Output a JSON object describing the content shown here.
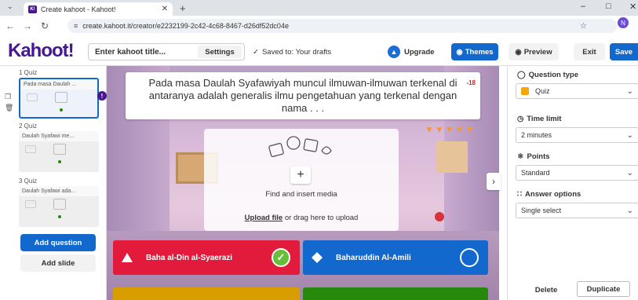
{
  "browser": {
    "tab_title": "Create kahoot - Kahoot!",
    "favicon": "K!",
    "url": "create.kahoot.it/creator/e2232199-2c42-4c68-8467-d26df52dc04e",
    "profile_initial": "N"
  },
  "header": {
    "logo": "Kahoot!",
    "title_placeholder": "Enter kahoot title...",
    "settings_label": "Settings",
    "saved_status": "Saved to: Your drafts",
    "upgrade_label": "Upgrade",
    "themes_label": "Themes",
    "preview_label": "Preview",
    "exit_label": "Exit",
    "save_label": "Save"
  },
  "sidebar": {
    "slides": [
      {
        "label": "1  Quiz",
        "preview": "Pada masa Daulah ..."
      },
      {
        "label": "2  Quiz",
        "preview": "Daulah Syafawi me..."
      },
      {
        "label": "3  Quiz",
        "preview": "Daulah Syafawi ada..."
      }
    ],
    "add_question_label": "Add question",
    "add_slide_label": "Add slide"
  },
  "editor": {
    "question_text": "Pada masa Daulah Syafawiyah muncul ilmuwan-ilmuwan terkenal di antaranya adalah generalis ilmu pengetahuan yang terkenal dengan nama . . .",
    "char_counter": "-18",
    "media": {
      "find_label": "Find and insert media",
      "upload_link": "Upload file",
      "upload_rest": " or drag here to upload"
    },
    "answers": [
      {
        "text": "Baha al-Din al-Syaerazi",
        "color": "#e21b3c",
        "shape": "triangle",
        "correct": true
      },
      {
        "text": "Baharuddin Al-Amili",
        "color": "#1368ce",
        "shape": "diamond",
        "correct": false
      },
      {
        "text": "",
        "color": "#d89e00",
        "shape": "circle",
        "correct": false
      },
      {
        "text": "",
        "color": "#26890c",
        "shape": "square",
        "correct": false
      }
    ]
  },
  "panel": {
    "question_type_label": "Question type",
    "question_type_value": "Quiz",
    "time_limit_label": "Time limit",
    "time_limit_value": "2 minutes",
    "points_label": "Points",
    "points_value": "Standard",
    "answer_options_label": "Answer options",
    "answer_options_value": "Single select",
    "delete_label": "Delete",
    "duplicate_label": "Duplicate"
  }
}
